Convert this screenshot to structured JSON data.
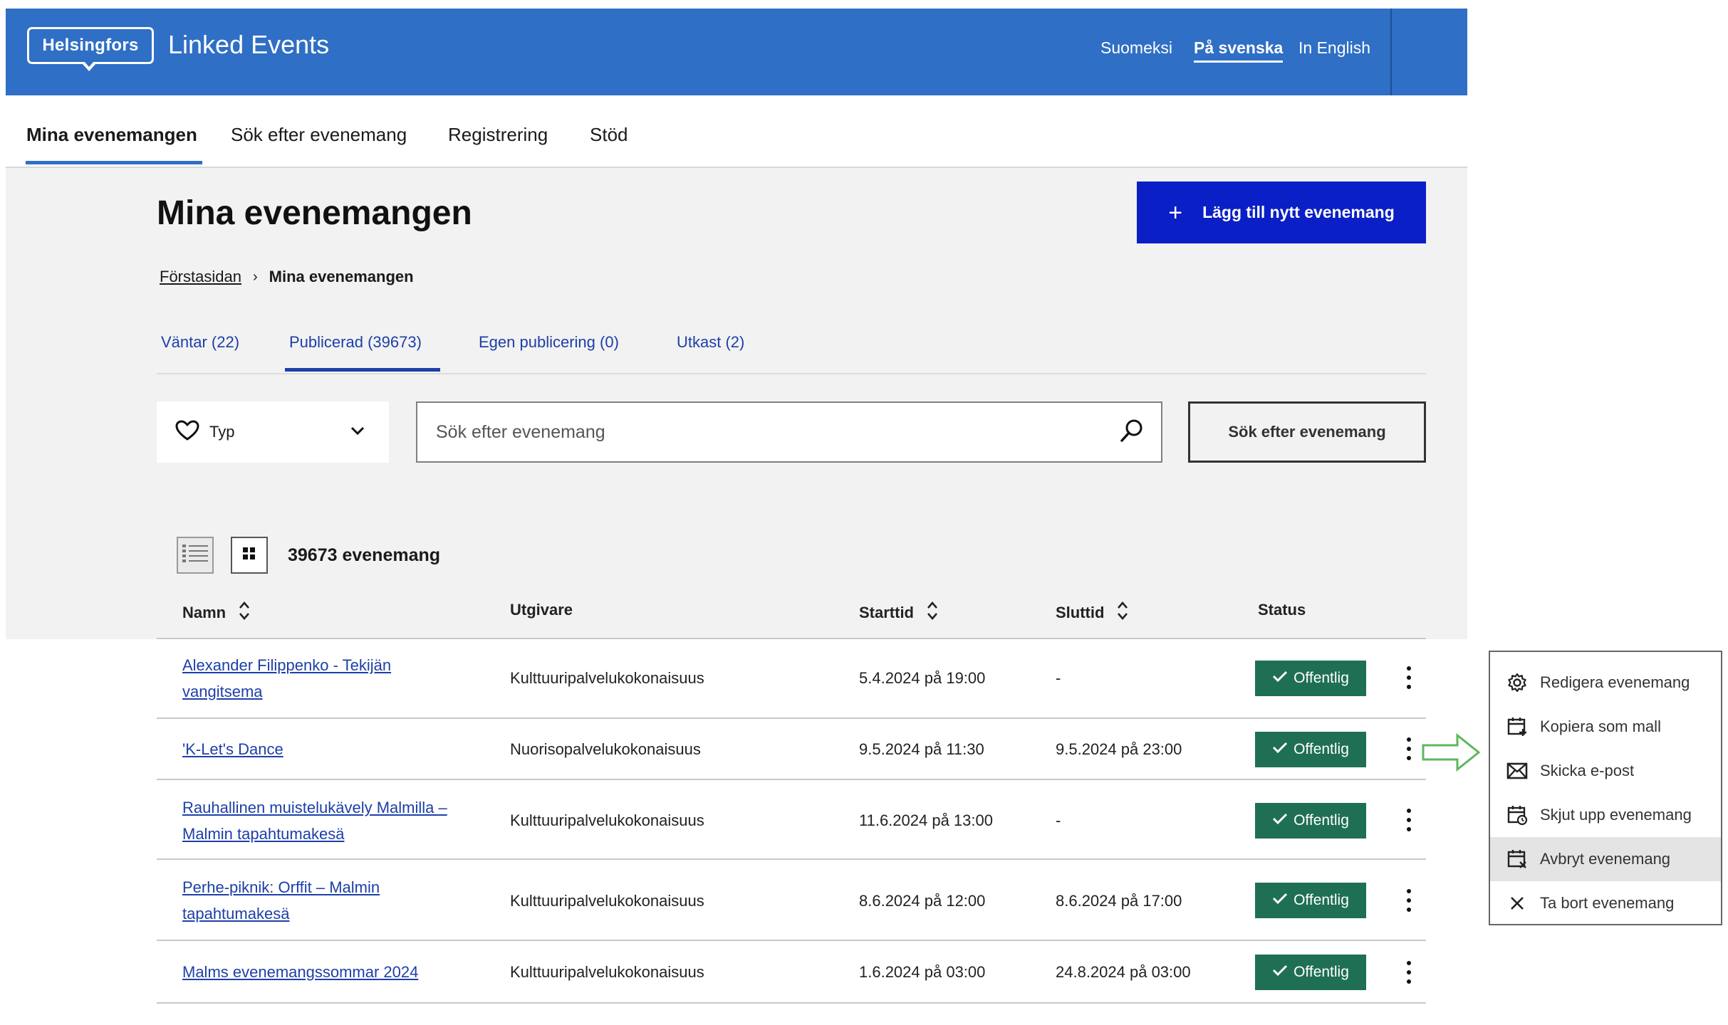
{
  "header": {
    "logo_text": "Helsingfors",
    "app_title": "Linked Events",
    "languages": [
      {
        "label": "Suomeksi",
        "active": false
      },
      {
        "label": "På svenska",
        "active": true
      },
      {
        "label": "In English",
        "active": false
      }
    ]
  },
  "nav": {
    "items": [
      {
        "label": "Mina evenemangen",
        "active": true
      },
      {
        "label": "Sök efter evenemang",
        "active": false
      },
      {
        "label": "Registrering",
        "active": false
      },
      {
        "label": "Stöd",
        "active": false
      }
    ]
  },
  "page": {
    "title": "Mina evenemangen",
    "add_button_label": "Lägg till nytt evenemang",
    "breadcrumb": {
      "home": "Förstasidan",
      "separator": "›",
      "current": "Mina evenemangen"
    }
  },
  "tabs": [
    {
      "label": "Väntar (22)",
      "active": false
    },
    {
      "label": "Publicerad (39673)",
      "active": true
    },
    {
      "label": "Egen publicering (0)",
      "active": false
    },
    {
      "label": "Utkast (2)",
      "active": false
    }
  ],
  "filters": {
    "type_label": "Typ",
    "search_placeholder": "Sök efter evenemang",
    "search_button_label": "Sök efter evenemang"
  },
  "results": {
    "count_label": "39673 evenemang",
    "columns": [
      "Namn",
      "Utgivare",
      "Starttid",
      "Sluttid",
      "Status"
    ],
    "rows": [
      {
        "name": "Alexander Filippenko - Tekijän vangitsema",
        "publisher": "Kulttuuripalvelukokonaisuus",
        "start": "5.4.2024 på 19:00",
        "end": "-",
        "status": "Offentlig"
      },
      {
        "name": "'K-Let's Dance",
        "publisher": "Nuorisopalvelukokonaisuus",
        "start": "9.5.2024 på 11:30",
        "end": "9.5.2024 på 23:00",
        "status": "Offentlig"
      },
      {
        "name": "Rauhallinen muistelukävely Malmilla – Malmin tapahtumakesä",
        "publisher": "Kulttuuripalvelukokonaisuus",
        "start": "11.6.2024 på 13:00",
        "end": "-",
        "status": "Offentlig"
      },
      {
        "name": "Perhe-piknik: Orffit – Malmin tapahtumakesä",
        "publisher": "Kulttuuripalvelukokonaisuus",
        "start": "8.6.2024 på 12:00",
        "end": "8.6.2024 på 17:00",
        "status": "Offentlig"
      },
      {
        "name": "Malms evenemangssommar 2024",
        "publisher": "Kulttuuripalvelukokonaisuus",
        "start": "1.6.2024 på 03:00",
        "end": "24.8.2024 på 03:00",
        "status": "Offentlig"
      }
    ]
  },
  "context_menu": {
    "items": [
      {
        "label": "Redigera evenemang",
        "icon": "gear-icon"
      },
      {
        "label": "Kopiera som mall",
        "icon": "calendar-plus-icon"
      },
      {
        "label": "Skicka e-post",
        "icon": "envelope-icon"
      },
      {
        "label": "Skjut upp evenemang",
        "icon": "calendar-clock-icon"
      },
      {
        "label": "Avbryt evenemang",
        "icon": "calendar-cancel-icon"
      },
      {
        "label": "Ta bort evenemang",
        "icon": "close-icon"
      }
    ]
  },
  "colors": {
    "header_bg": "#2f6fc5",
    "primary_button": "#0a1fc5",
    "status_badge": "#1f6f55",
    "link": "#1d3fa8",
    "arrow": "#5cb85c"
  }
}
